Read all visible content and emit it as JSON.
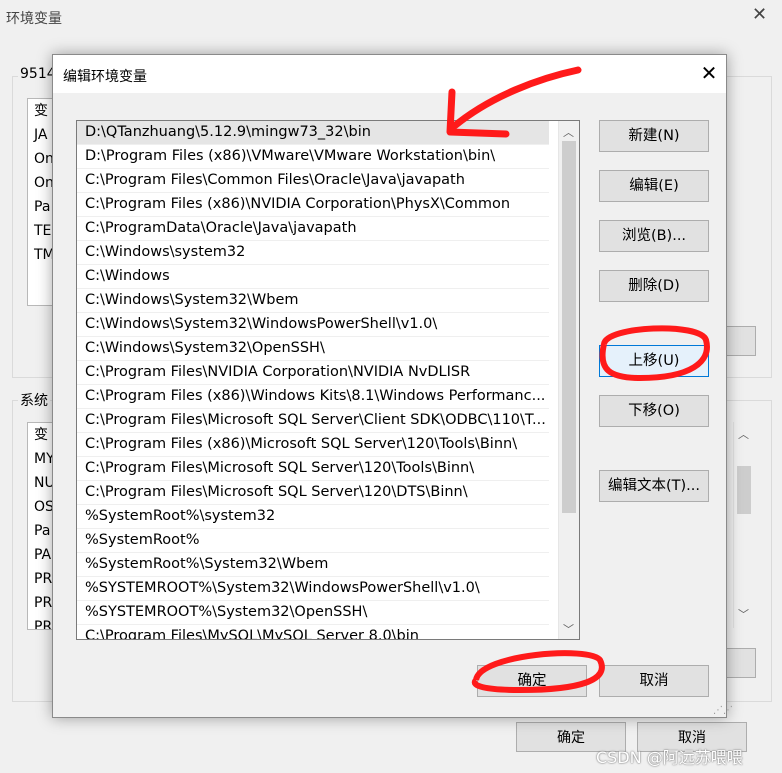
{
  "background_window": {
    "title": "环境变量",
    "close_glyph": "✕",
    "user_group_label": "9514",
    "user_list_items": [
      "变",
      "JA",
      "On",
      "On",
      "Pa",
      "TE",
      "TM"
    ],
    "system_group_label": "系统",
    "system_list_items": [
      "变",
      "MY",
      "NU",
      "OS",
      "Pa",
      "PA",
      "PR",
      "PR",
      "PR"
    ],
    "ok_label": "确定",
    "cancel_label": "取消"
  },
  "dialog": {
    "title": "编辑环境变量",
    "close_glyph": "✕",
    "paths": [
      "D:\\QTanzhuang\\5.12.9\\mingw73_32\\bin",
      "D:\\Program Files (x86)\\VMware\\VMware Workstation\\bin\\",
      "C:\\Program Files\\Common Files\\Oracle\\Java\\javapath",
      "C:\\Program Files (x86)\\NVIDIA Corporation\\PhysX\\Common",
      "C:\\ProgramData\\Oracle\\Java\\javapath",
      "C:\\Windows\\system32",
      "C:\\Windows",
      "C:\\Windows\\System32\\Wbem",
      "C:\\Windows\\System32\\WindowsPowerShell\\v1.0\\",
      "C:\\Windows\\System32\\OpenSSH\\",
      "C:\\Program Files\\NVIDIA Corporation\\NVIDIA NvDLISR",
      "C:\\Program Files (x86)\\Windows Kits\\8.1\\Windows Performanc...",
      "C:\\Program Files\\Microsoft SQL Server\\Client SDK\\ODBC\\110\\T...",
      "C:\\Program Files (x86)\\Microsoft SQL Server\\120\\Tools\\Binn\\",
      "C:\\Program Files\\Microsoft SQL Server\\120\\Tools\\Binn\\",
      "C:\\Program Files\\Microsoft SQL Server\\120\\DTS\\Binn\\",
      "%SystemRoot%\\system32",
      "%SystemRoot%",
      "%SystemRoot%\\System32\\Wbem",
      "%SYSTEMROOT%\\System32\\WindowsPowerShell\\v1.0\\",
      "%SYSTEMROOT%\\System32\\OpenSSH\\",
      "C:\\Program Files\\MySQL\\MySQL Server 8.0\\bin"
    ],
    "selected_index": 0,
    "buttons": {
      "new": "新建(N)",
      "edit": "编辑(E)",
      "browse": "浏览(B)...",
      "delete": "删除(D)",
      "move_up": "上移(U)",
      "move_down": "下移(O)",
      "edit_text": "编辑文本(T)...",
      "ok": "确定",
      "cancel": "取消"
    },
    "scroll_up_glyph": "︿",
    "scroll_down_glyph": "﹀"
  },
  "watermark": "CSDN @阿远苏喂喂",
  "colors": {
    "annotation_red": "#ff1a1a",
    "focus_blue": "#0078d7"
  }
}
